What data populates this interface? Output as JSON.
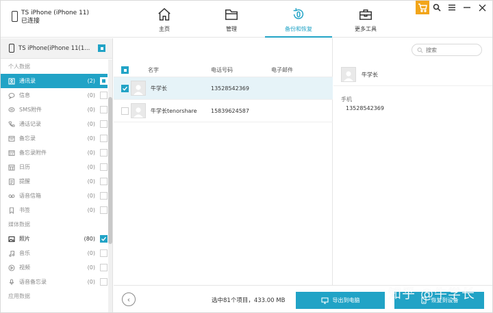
{
  "device": {
    "name": "TS iPhone (iPhone 11)",
    "status": "已连接"
  },
  "nav": [
    {
      "label": "主页",
      "icon": "home-icon"
    },
    {
      "label": "管理",
      "icon": "folder-icon"
    },
    {
      "label": "备份和恢复",
      "icon": "backup-restore-icon",
      "active": true
    },
    {
      "label": "更多工具",
      "icon": "toolbox-icon"
    }
  ],
  "window_controls": {
    "cart_icon": "cart-icon",
    "search_icon": "search-icon",
    "menu_icon": "menu-icon",
    "minimize_icon": "minimize-icon",
    "close_icon": "close-icon"
  },
  "sidebar": {
    "device_label": "TS iPhone(iPhone 11(1...",
    "sections": [
      {
        "title": "个人数据",
        "items": [
          {
            "label": "通讯录",
            "count": "(2)",
            "icon": "contacts-icon",
            "selected": true
          },
          {
            "label": "信息",
            "count": "(0)",
            "icon": "message-icon"
          },
          {
            "label": "SMS附件",
            "count": "(0)",
            "icon": "attachment-icon"
          },
          {
            "label": "通话记录",
            "count": "(0)",
            "icon": "call-log-icon"
          },
          {
            "label": "备忘录",
            "count": "(0)",
            "icon": "notes-icon"
          },
          {
            "label": "备忘录附件",
            "count": "(0)",
            "icon": "notes-attachment-icon"
          },
          {
            "label": "日历",
            "count": "(0)",
            "icon": "calendar-icon"
          },
          {
            "label": "提醒",
            "count": "(0)",
            "icon": "reminder-icon"
          },
          {
            "label": "语音信箱",
            "count": "(0)",
            "icon": "voicemail-icon"
          },
          {
            "label": "书签",
            "count": "(0)",
            "icon": "bookmark-icon"
          }
        ]
      },
      {
        "title": "媒体数据",
        "items": [
          {
            "label": "照片",
            "count": "(80)",
            "icon": "photo-icon",
            "checked": true
          },
          {
            "label": "音乐",
            "count": "(0)",
            "icon": "music-icon"
          },
          {
            "label": "视频",
            "count": "(0)",
            "icon": "video-icon"
          },
          {
            "label": "语音备忘录",
            "count": "(0)",
            "icon": "voice-memo-icon"
          }
        ]
      },
      {
        "title": "应用数据",
        "items": []
      }
    ]
  },
  "search": {
    "placeholder": "搜索"
  },
  "list": {
    "headers": {
      "name": "名字",
      "phone": "电话号码",
      "email": "电子邮件"
    },
    "rows": [
      {
        "name": "牛学长",
        "phone": "13528542369",
        "email": "",
        "checked": true,
        "selected": true
      },
      {
        "name": "牛学长tenorshare",
        "phone": "15839624587",
        "email": "",
        "checked": false,
        "selected": false
      }
    ]
  },
  "detail": {
    "name": "牛学长",
    "field_label": "手机",
    "field_value": "13528542369"
  },
  "bottom": {
    "summary": "选中81个项目，433.00 MB",
    "export_label": "导出到电脑",
    "restore_label": "恢复到设备"
  },
  "watermark": "知乎 @牛学长",
  "colors": {
    "accent": "#21a3c6",
    "cart": "#f2a51a"
  }
}
